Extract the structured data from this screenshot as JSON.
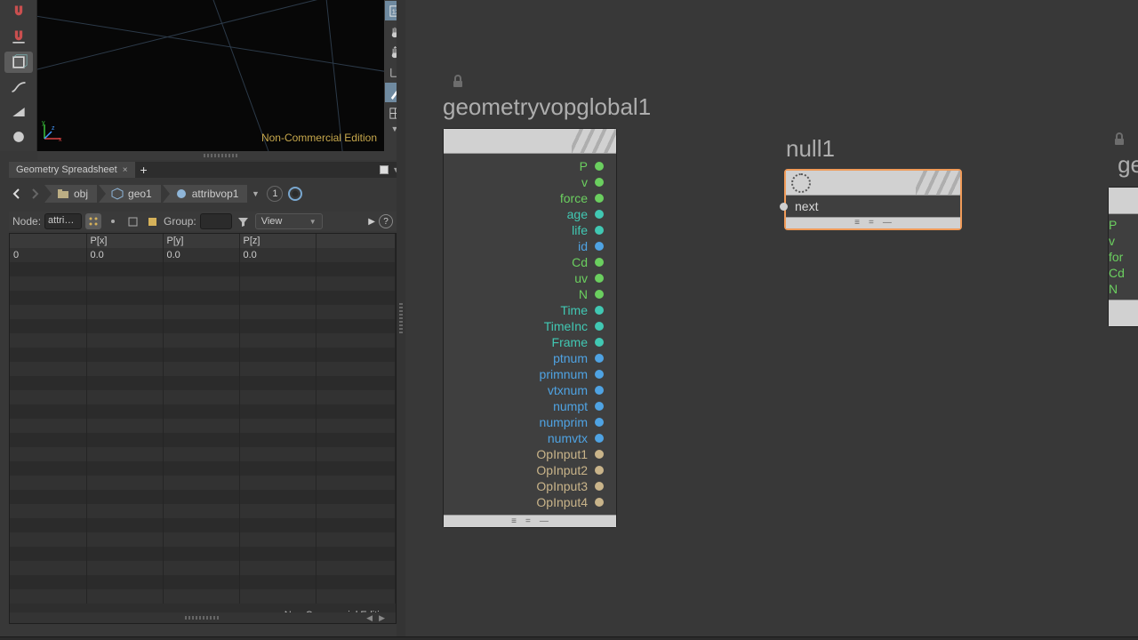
{
  "viewport": {
    "edition_label": "Non-Commercial Edition"
  },
  "tabbar": {
    "tab_label": "Geometry Spreadsheet",
    "close_glyph": "×",
    "add_glyph": "+"
  },
  "pathbar": {
    "crumbs": [
      "obj",
      "geo1",
      "attribvop1"
    ],
    "pill_value": "1"
  },
  "filterrow": {
    "node_label": "Node:",
    "node_value": "attri…",
    "group_label": "Group:",
    "view_label": "View",
    "help_glyph": "?"
  },
  "sheet": {
    "headers": [
      "",
      "P[x]",
      "P[y]",
      "P[z]",
      ""
    ],
    "rows": [
      {
        "idx": "0",
        "px": "0.0",
        "py": "0.0",
        "pz": "0.0"
      }
    ],
    "footer": "Non-Commercial Edition",
    "blank_rows": 24
  },
  "network": {
    "global_node": {
      "title": "geometryvopglobal1",
      "outputs": [
        {
          "name": "P",
          "c": "green"
        },
        {
          "name": "v",
          "c": "green"
        },
        {
          "name": "force",
          "c": "green"
        },
        {
          "name": "age",
          "c": "teal"
        },
        {
          "name": "life",
          "c": "teal"
        },
        {
          "name": "id",
          "c": "blue"
        },
        {
          "name": "Cd",
          "c": "green"
        },
        {
          "name": "uv",
          "c": "green"
        },
        {
          "name": "N",
          "c": "green"
        },
        {
          "name": "Time",
          "c": "teal"
        },
        {
          "name": "TimeInc",
          "c": "teal"
        },
        {
          "name": "Frame",
          "c": "teal"
        },
        {
          "name": "ptnum",
          "c": "blue"
        },
        {
          "name": "primnum",
          "c": "blue"
        },
        {
          "name": "vtxnum",
          "c": "blue"
        },
        {
          "name": "numpt",
          "c": "blue"
        },
        {
          "name": "numprim",
          "c": "blue"
        },
        {
          "name": "numvtx",
          "c": "blue"
        },
        {
          "name": "OpInput1",
          "c": "tan"
        },
        {
          "name": "OpInput2",
          "c": "tan"
        },
        {
          "name": "OpInput3",
          "c": "tan"
        },
        {
          "name": "OpInput4",
          "c": "tan"
        }
      ]
    },
    "null_node": {
      "title": "null1",
      "input_label": "next"
    },
    "out_node": {
      "title": "ge",
      "inputs": [
        {
          "name": "P",
          "c": "green"
        },
        {
          "name": "v",
          "c": "green"
        },
        {
          "name": "for",
          "c": "green"
        },
        {
          "name": "Cd",
          "c": "green"
        },
        {
          "name": "N",
          "c": "green"
        }
      ]
    }
  }
}
